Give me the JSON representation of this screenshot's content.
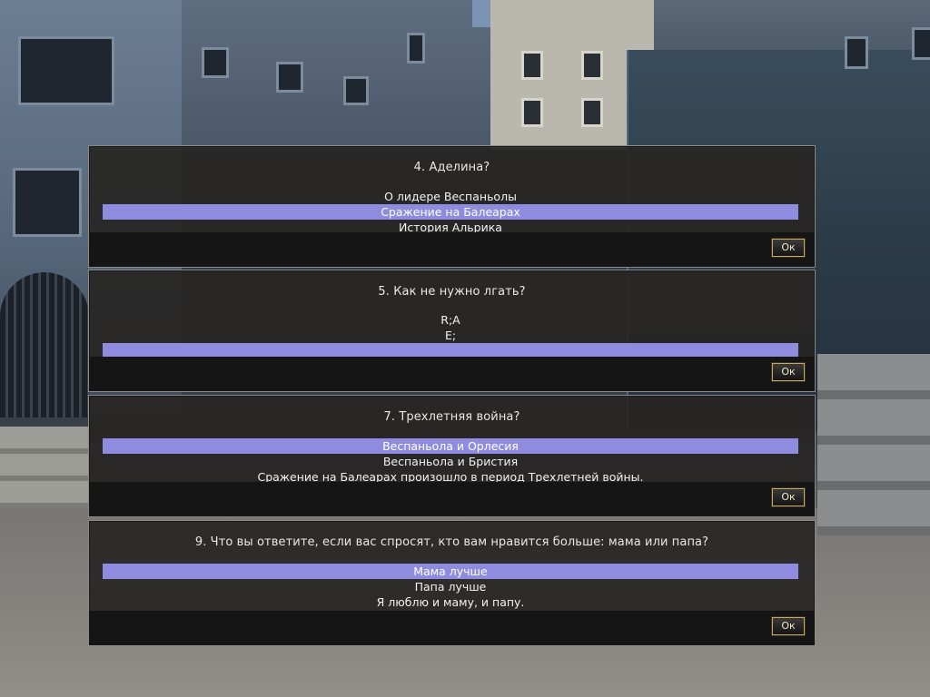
{
  "dialogs": [
    {
      "question": "4. Аделина?",
      "answers": [
        "О лидере Веспаньолы",
        "Сражение на Балеарах",
        "История Альрика"
      ],
      "selected_index": 1,
      "ok_label": "Ок"
    },
    {
      "question": "5. Как не нужно лгать?",
      "answers": [
        "R;A",
        "E;",
        ""
      ],
      "selected_index": 2,
      "ok_label": "Ок"
    },
    {
      "question": "7. Трехлетняя война?",
      "answers": [
        "Веспаньола и Орлесия",
        "Веспаньола и Бристия",
        "Сражение на Балеарах произошло в период Трехлетней войны."
      ],
      "selected_index": 0,
      "ok_label": "Ок"
    },
    {
      "question": "9. Что вы ответите, если вас спросят, кто вам нравится больше: мама или папа?",
      "answers": [
        "Мама лучше",
        "Папа лучше",
        "Я люблю и маму, и папу."
      ],
      "selected_index": 0,
      "ok_label": "Ок"
    }
  ],
  "colors": {
    "selection": "#8f8ce0",
    "panel": "#282624",
    "footer": "#151515",
    "button_border": "#c8a860"
  }
}
